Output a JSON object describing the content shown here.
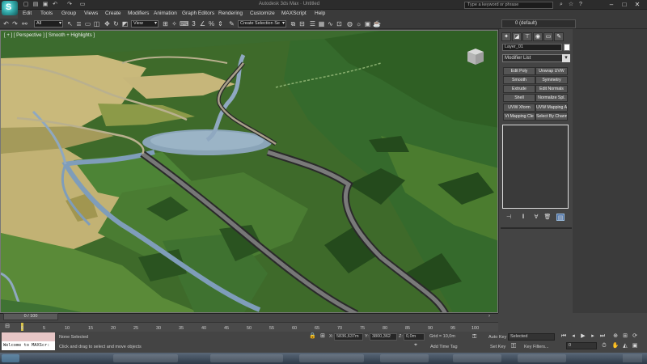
{
  "titlebar": {
    "window_title": "Autodesk 3ds Max  ·  Untitled",
    "search_placeholder": "Type a keyword or phrase"
  },
  "menubar": {
    "items": [
      "Edit",
      "Tools",
      "Group",
      "Views",
      "Create",
      "Modifiers",
      "Animation",
      "Graph Editors",
      "Rendering",
      "Customize",
      "MAXScript",
      "Help"
    ]
  },
  "toolbar": {
    "selection_filter": "All",
    "reference_coord": "View",
    "named_selection_placeholder": "Create Selection Se"
  },
  "viewport": {
    "label": "[ + ] [ Perspective ] [ Smooth + Highlights ]"
  },
  "command_panel": {
    "layer_label": "0 (default)",
    "object_name": "Layer_01",
    "modifier_list_label": "Modifier List",
    "modifier_buttons": [
      "Edit Poly",
      "Unwrap UVW",
      "Smooth",
      "Symmetry",
      "Extrude",
      "Edit Normals",
      "Shell",
      "Normalize Spl.",
      "UVW Xform",
      "UVW Mapping Ad",
      "Vt Mapping Cle",
      "Select By Channe"
    ]
  },
  "timeline": {
    "frame_display": "0 / 100",
    "ticks": [
      "0",
      "5",
      "10",
      "15",
      "20",
      "25",
      "30",
      "35",
      "40",
      "45",
      "50",
      "55",
      "60",
      "65",
      "70",
      "75",
      "80",
      "85",
      "90",
      "95",
      "100"
    ]
  },
  "status": {
    "maxscript_output": "Welcome to MAXScr:",
    "selection_status": "None Selected",
    "prompt": "Click and drag to select and move objects",
    "x_label": "X:",
    "x_value": "5836,637m",
    "y_label": "Y:",
    "y_value": "3800,362",
    "z_label": "Z:",
    "z_value": "0,0m",
    "grid": "Grid = 10,0m",
    "add_time_tag": "Add Time Tag",
    "auto_key": "Auto Key",
    "set_key": "Set Key",
    "key_mode": "Selected",
    "key_filters": "Key Filters...",
    "current_frame": "0"
  }
}
